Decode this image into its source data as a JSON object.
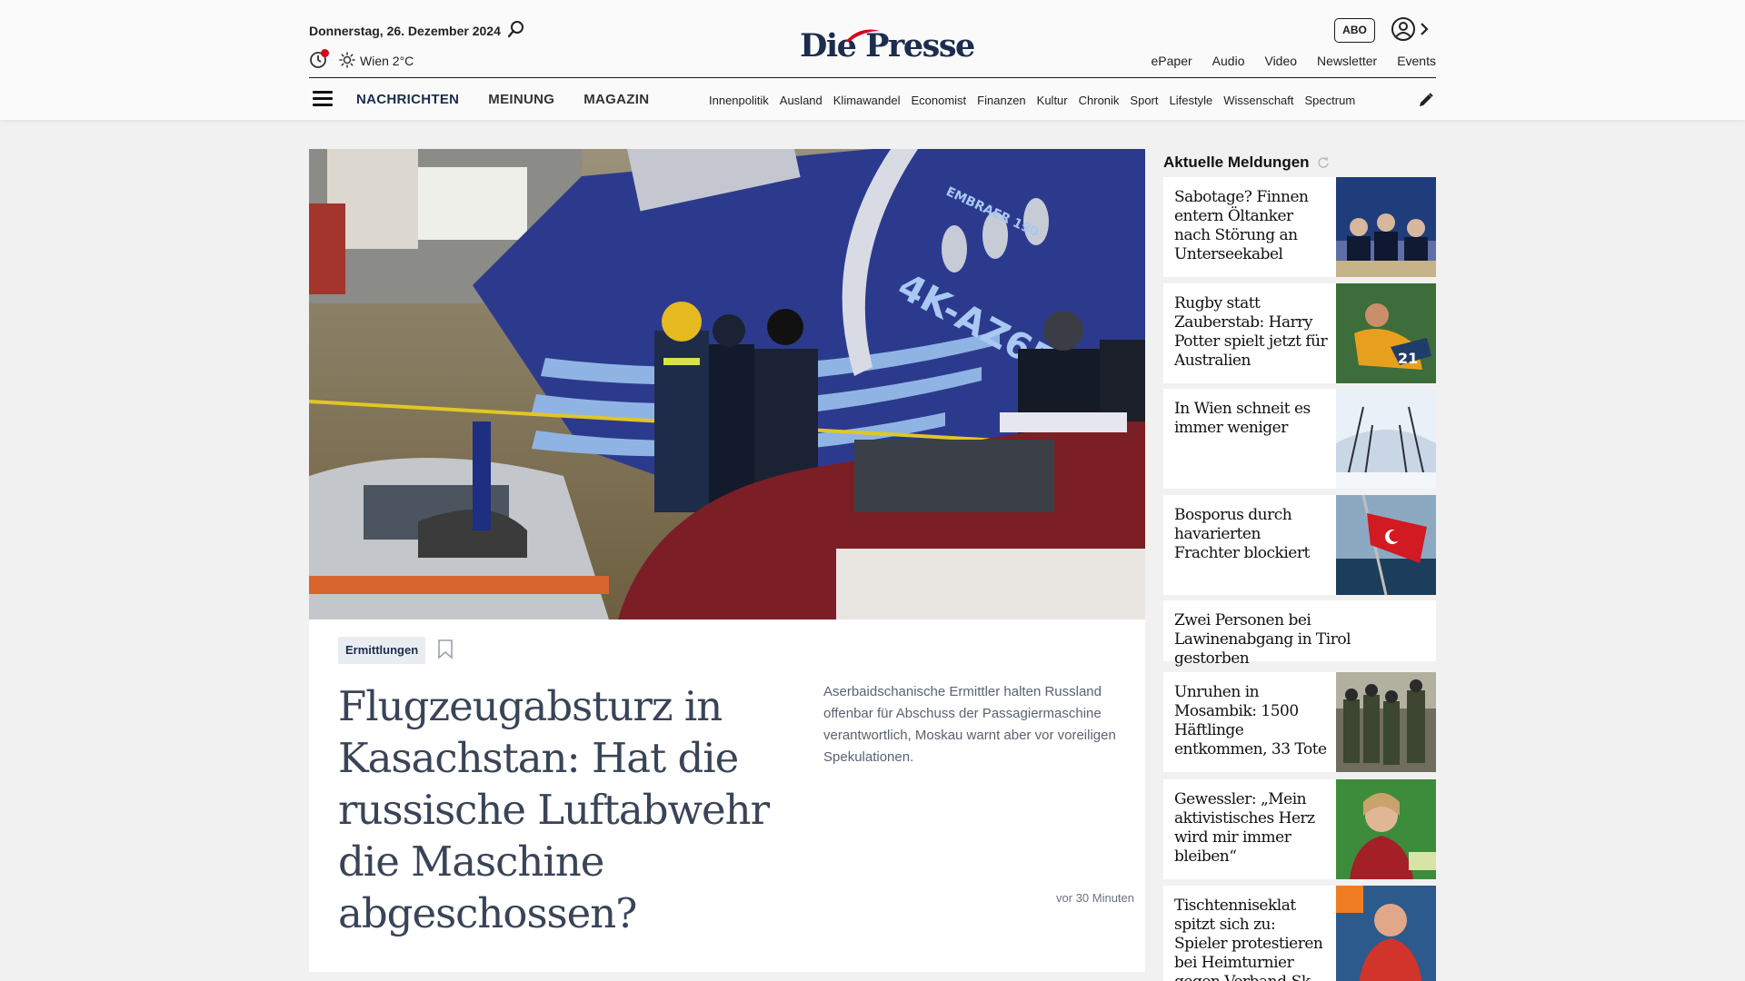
{
  "header": {
    "date": "Donnerstag, 26. Dezember 2024",
    "weather": "Wien 2°C",
    "logo": "Die Presse",
    "abo_label": "ABO",
    "util_links": [
      "ePaper",
      "Audio",
      "Video",
      "Newsletter",
      "Events"
    ]
  },
  "nav": {
    "main": [
      "NACHRICHTEN",
      "MEINUNG",
      "MAGAZIN"
    ],
    "sub": [
      "Innenpolitik",
      "Ausland",
      "Klimawandel",
      "Economist",
      "Finanzen",
      "Kultur",
      "Chronik",
      "Sport",
      "Lifestyle",
      "Wissenschaft",
      "Spectrum"
    ]
  },
  "lead": {
    "tag": "Ermittlungen",
    "headline": "Flugzeugabsturz in Kasachstan: Hat die russische Luftabwehr die Maschine abgeschossen?",
    "teaser": "Aserbaidschanische Ermittler halten Russland offenbar für Abschuss der Passagiermaschine verantwortlich, Moskau warnt aber vor voreiligen Spekulationen.",
    "time": "vor 30 Minuten",
    "image_text": {
      "registration": "4K-AZ65",
      "model": "EMBRAER 190"
    }
  },
  "sidebar": {
    "title": "Aktuelle Meldungen",
    "items": [
      {
        "text": "Sabotage? Finnen entern Öltanker nach Störung an Unterseekabel"
      },
      {
        "text": "Rugby statt Zauberstab: Harry Potter spielt jetzt für Australien"
      },
      {
        "text": "In Wien schneit es immer weniger"
      },
      {
        "text": "Bosporus durch havarierten Frachter blockiert"
      },
      {
        "text": "Zwei Personen bei Lawinenabgang in Tirol gestorben"
      },
      {
        "text": "Unruhen in Mosambik: 1500 Häftlinge entkommen, 33 Tote"
      },
      {
        "text": "Gewessler: „Mein aktivistisches Herz wird mir immer bleiben“"
      },
      {
        "text": "Tischtenniseklat spitzt sich zu: Spieler protestieren bei Heimturnier gegen Verband-Sk"
      }
    ]
  },
  "colors": {
    "brand_navy": "#1c2d4d",
    "logo_red": "#d6001c",
    "background": "#f1f1f1"
  }
}
